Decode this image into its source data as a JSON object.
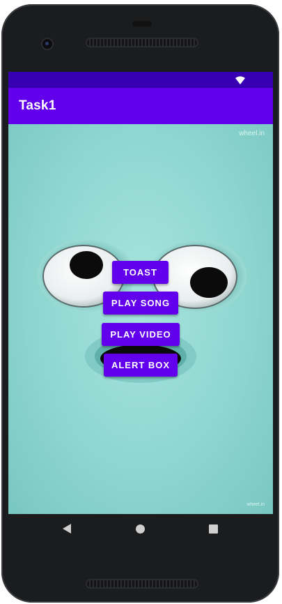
{
  "app": {
    "title": "Task1"
  },
  "status_bar": {
    "icons": [
      "wifi-icon"
    ],
    "color": "#3700b3"
  },
  "accent": "#6200ee",
  "watermark": {
    "text": "wheel.in"
  },
  "buttons": {
    "toast": "TOAST",
    "play_song": "PLAY SONG",
    "play_video": "PLAY VIDEO",
    "alert_box": "ALERT BOX"
  },
  "nav": {
    "icons": [
      "back-icon",
      "home-icon",
      "recents-icon"
    ]
  }
}
